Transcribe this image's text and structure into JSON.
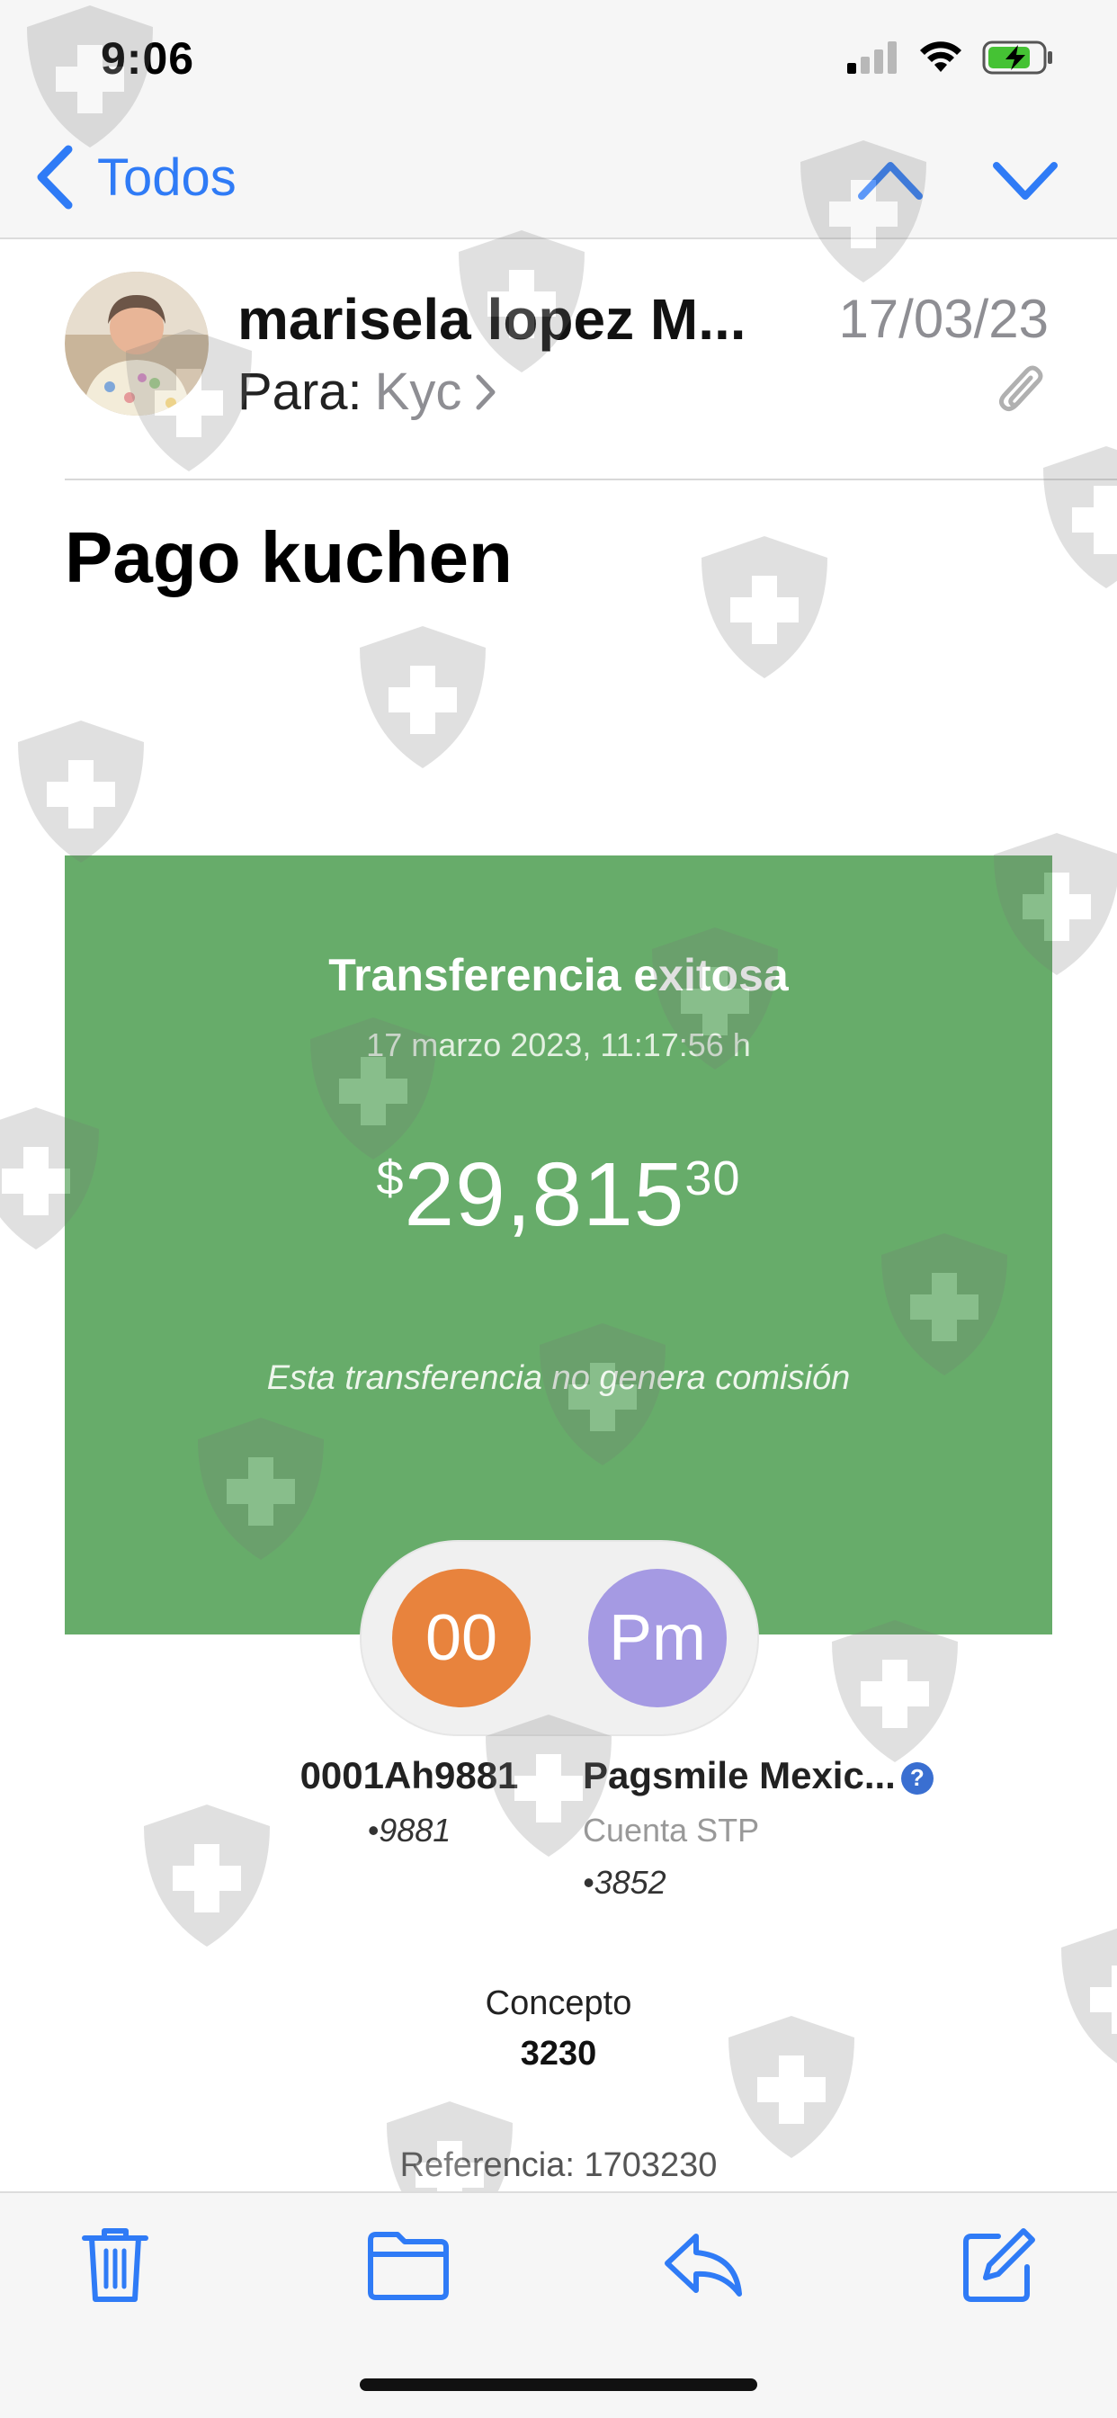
{
  "status_bar": {
    "time": "9:06"
  },
  "nav": {
    "back_label": "Todos"
  },
  "header": {
    "sender": "marisela lopez M...",
    "date": "17/03/23",
    "to_label": "Para:",
    "to_name": "Kyc"
  },
  "subject": "Pago kuchen",
  "receipt": {
    "title": "Transferencia exitosa",
    "datetime": "17 marzo 2023, 11:17:56 h",
    "amount_symbol": "$",
    "amount_main": "29,815",
    "amount_cents": "30",
    "note": "Esta transferencia no genera comisión",
    "from": {
      "initials": "00",
      "name": "0001Ah9881",
      "number": "•9881"
    },
    "to": {
      "initials": "Pm",
      "name": "Pagsmile Mexic...",
      "help": "?",
      "account_type": "Cuenta STP",
      "number": "•3852"
    },
    "concept_label": "Concepto",
    "concept_value": "3230",
    "reference": "Referencia: 1703230"
  },
  "colors": {
    "accent": "#2f7bf6",
    "receipt_green": "#67ac6a",
    "orange": "#e8833d",
    "purple": "#a59ae3"
  },
  "icons": [
    "signal-icon",
    "wifi-icon",
    "battery-charging-icon",
    "chevron-left-icon",
    "chevron-up-icon",
    "chevron-down-icon",
    "chevron-right-icon",
    "paperclip-icon",
    "trash-icon",
    "folder-icon",
    "reply-icon",
    "compose-icon",
    "watermark-shield-icon"
  ]
}
